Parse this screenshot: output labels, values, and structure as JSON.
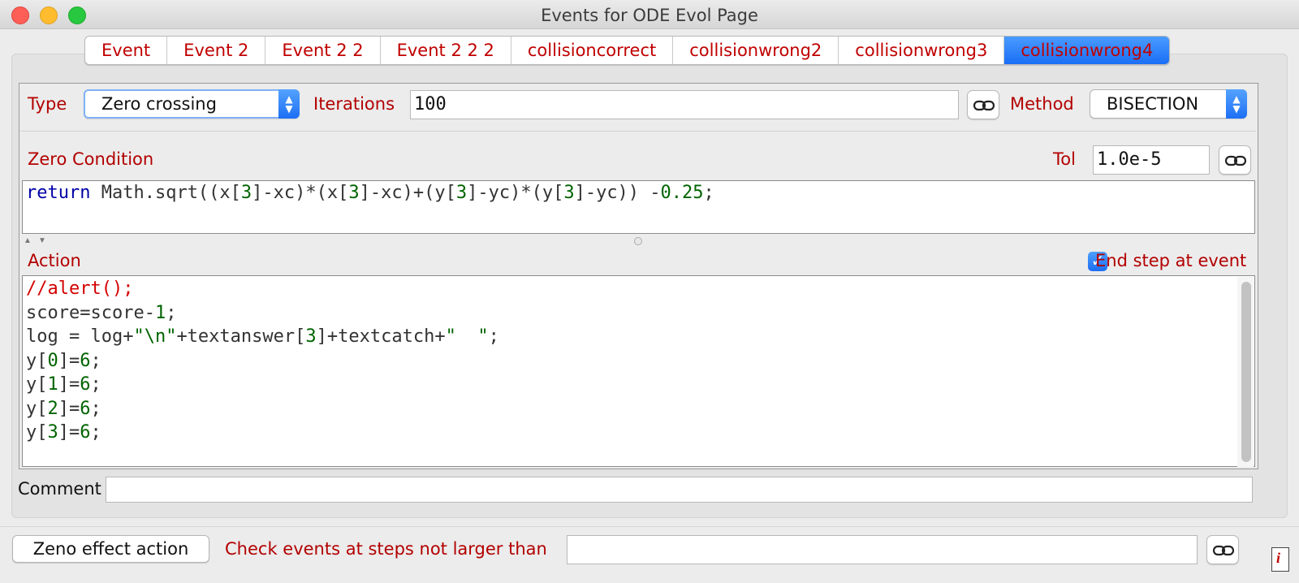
{
  "window": {
    "title": "Events for ODE Evol Page"
  },
  "tabs": [
    {
      "label": "Event"
    },
    {
      "label": "Event 2"
    },
    {
      "label": "Event 2 2"
    },
    {
      "label": "Event 2 2 2"
    },
    {
      "label": "collisioncorrect"
    },
    {
      "label": "collisionwrong2"
    },
    {
      "label": "collisionwrong3"
    },
    {
      "label": "collisionwrong4",
      "active": true
    }
  ],
  "event": {
    "type_label": "Type",
    "type_value": "Zero crossing",
    "iterations_label": "Iterations",
    "iterations_value": "100",
    "method_label": "Method",
    "method_value": "BISECTION",
    "zero_condition_label": "Zero Condition",
    "tol_label": "Tol",
    "tol_value": "1.0e-5",
    "action_label": "Action",
    "end_step_label": "End step at event",
    "end_step_checked": true,
    "comment_label": "Comment",
    "comment_value": ""
  },
  "zero_condition_code": "return Math.sqrt((x[3]-xc)*(x[3]-xc)+(y[3]-yc)*(y[3]-yc)) -0.25;",
  "action_code": [
    "//alert();",
    "score=score-1;",
    "log = log+\"\\n\"+textanswer[3]+textcatch+\"  \";",
    "y[0]=6;",
    "y[1]=6;",
    "y[2]=6;",
    "y[3]=6;"
  ],
  "footer": {
    "zeno_button": "Zeno effect action",
    "check_label": "Check events at steps not larger than",
    "check_value": ""
  },
  "icons": {
    "link": "link-chain-icon",
    "info": "info-icon"
  },
  "colors": {
    "label_red": "#b30000",
    "active_tab": "#1a6ff5",
    "keyword": "#0000a8",
    "number": "#006400",
    "comment": "#d40000"
  }
}
